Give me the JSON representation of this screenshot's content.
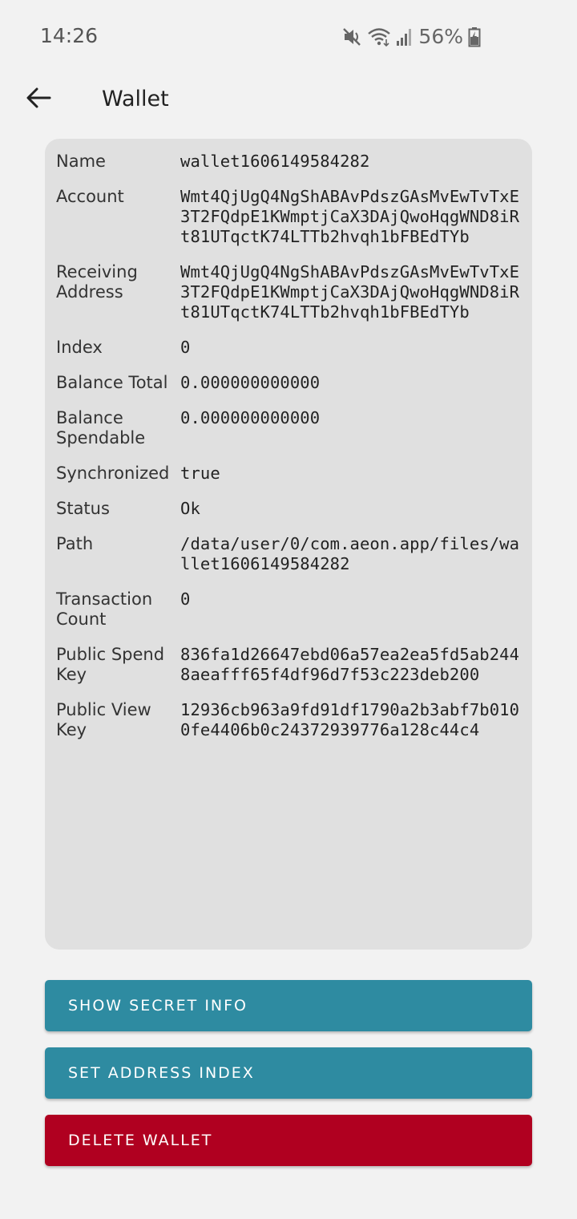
{
  "status_bar": {
    "time": "14:26",
    "battery": "56%",
    "icons": [
      "mute-icon",
      "wifi-icon",
      "signal-icon",
      "battery-icon"
    ]
  },
  "toolbar": {
    "title": "Wallet",
    "back_icon": "arrow-left-icon"
  },
  "wallet_info": [
    {
      "label": "Name",
      "value": "wallet1606149584282"
    },
    {
      "label": "Account",
      "value": "Wmt4QjUgQ4NgShABAvPdszGAsMvEwTvTxE3T2FQdpE1KWmptjCaX3DAjQwoHqgWND8iRt81UTqctK74LTTb2hvqh1bFBEdTYb"
    },
    {
      "label": "Receiving Address",
      "value": "Wmt4QjUgQ4NgShABAvPdszGAsMvEwTvTxE3T2FQdpE1KWmptjCaX3DAjQwoHqgWND8iRt81UTqctK74LTTb2hvqh1bFBEdTYb"
    },
    {
      "label": "Index",
      "value": "0"
    },
    {
      "label": "Balance Total",
      "value": "0.000000000000"
    },
    {
      "label": "Balance Spendable",
      "value": "0.000000000000"
    },
    {
      "label": "Synchronized",
      "value": "true"
    },
    {
      "label": "Status",
      "value": "Ok"
    },
    {
      "label": "Path",
      "value": "/data/user/0/com.aeon.app/files/wallet1606149584282"
    },
    {
      "label": "Transaction Count",
      "value": "0"
    },
    {
      "label": "Public Spend Key",
      "value": "836fa1d26647ebd06a57ea2ea5fd5ab2448aeafff65f4df96d7f53c223deb200"
    },
    {
      "label": "Public View Key",
      "value": "12936cb963a9fd91df1790a2b3abf7b0100fe4406b0c24372939776a128c44c4"
    }
  ],
  "buttons": {
    "show_secret": "SHOW SECRET INFO",
    "set_address_index": "SET ADDRESS INDEX",
    "delete_wallet": "DELETE WALLET"
  },
  "colors": {
    "primary_button": "#2e8ba1",
    "danger_button": "#b00020",
    "card_background": "#e0e0e0",
    "page_background": "#f2f2f2"
  }
}
